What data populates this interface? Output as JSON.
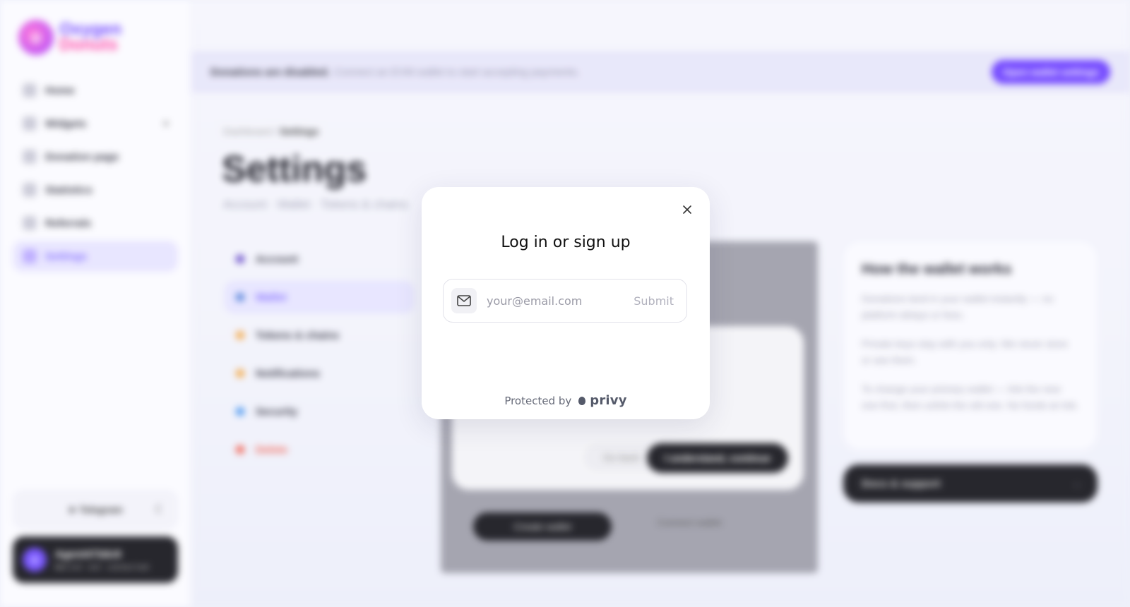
{
  "sidebar": {
    "logo": {
      "line1": "Oxygen",
      "line2": "Donuts"
    },
    "items": [
      {
        "label": "Home",
        "icon": "home-icon"
      },
      {
        "label": "Widgets",
        "icon": "widgets-icon",
        "chevron": "▾"
      },
      {
        "label": "Donation page",
        "icon": "page-icon"
      },
      {
        "label": "Statistics",
        "icon": "chart-icon"
      },
      {
        "label": "Referrals",
        "icon": "gift-icon"
      },
      {
        "label": "Settings",
        "icon": "gear-icon",
        "active": true
      }
    ],
    "telegram_label": "Telegram",
    "user": {
      "initial": "A",
      "name": "Agent473dc8",
      "status": "Wallet not connected"
    }
  },
  "banner": {
    "bold": "Donations are disabled.",
    "text": "Connect an EVM wallet to start accepting payments.",
    "button": "Open wallet settings"
  },
  "breadcrumb": {
    "root": "Dashboard",
    "sep": "/",
    "current": "Settings"
  },
  "page": {
    "title": "Settings",
    "subtitle": "Account · Wallet · Tokens & chains"
  },
  "settings_nav": [
    {
      "label": "Account",
      "color": "#5b3cc4"
    },
    {
      "label": "Wallet",
      "color": "#4a7bd8",
      "active": true
    },
    {
      "label": "Tokens & chains",
      "color": "#f2a23a"
    },
    {
      "label": "Notifications",
      "color": "#f2a23a"
    },
    {
      "label": "Security",
      "color": "#3b8ef0"
    },
    {
      "label": "Delete",
      "color": "#f05a4a",
      "danger": true
    }
  ],
  "wallet_panel": {
    "go_back": "Go back",
    "understand": "I understand, continue",
    "create_wallet": "Create wallet",
    "connect_wallet": "Connect wallet"
  },
  "info_card": {
    "title": "How the wallet works",
    "p1": "Donations land in your wallet instantly — no platform delays or fees.",
    "p2": "Private keys stay with you only. We never store or see them.",
    "p3": "To change your primary wallet — link the new one first, then unlink the old one. No funds at risk."
  },
  "docs_button": "Docs & support",
  "modal": {
    "title": "Log in or sign up",
    "email_placeholder": "your@email.com",
    "submit": "Submit",
    "protected_by": "Protected by",
    "brand": "privy"
  },
  "colors": {
    "accent": "#6a3cff",
    "dark": "#15151c"
  }
}
